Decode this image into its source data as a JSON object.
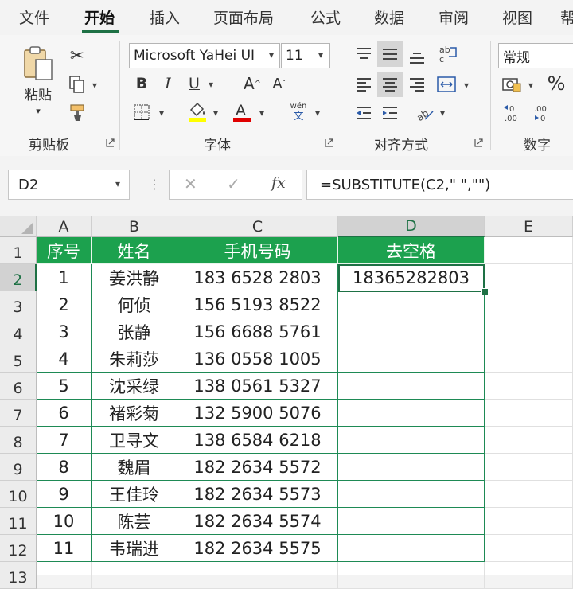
{
  "tabs": [
    "文件",
    "开始",
    "插入",
    "页面布局",
    "公式",
    "数据",
    "审阅",
    "视图",
    "帮"
  ],
  "active_tab": "开始",
  "ribbon": {
    "clipboard": {
      "paste_label": "粘贴",
      "group_label": "剪贴板"
    },
    "font": {
      "font_name": "Microsoft YaHei UI",
      "font_size": "11",
      "bold": "B",
      "italic": "I",
      "underline": "U",
      "grow": "A",
      "shrink": "A",
      "phonetic_top": "wén",
      "phonetic_bottom": "文",
      "group_label": "字体",
      "highlight_color": "#ffff00",
      "font_color": "#e00000"
    },
    "alignment": {
      "group_label": "对齐方式"
    },
    "number": {
      "format": "常规",
      "percent": "%",
      "group_label": "数字"
    }
  },
  "formula_bar": {
    "name_box": "D2",
    "fx": "fx",
    "formula": "=SUBSTITUTE(C2,\" \",\"\")"
  },
  "sheet": {
    "columns": [
      "A",
      "B",
      "C",
      "D",
      "E"
    ],
    "selected_column": "D",
    "selected_row": "2",
    "row_numbers": [
      "1",
      "2",
      "3",
      "4",
      "5",
      "6",
      "7",
      "8",
      "9",
      "10",
      "11",
      "12",
      "13"
    ],
    "headers": [
      "序号",
      "姓名",
      "手机号码",
      "去空格"
    ],
    "rows": [
      [
        "1",
        "姜洪静",
        "183 6528 2803",
        "18365282803"
      ],
      [
        "2",
        "何侦",
        "156 5193 8522",
        ""
      ],
      [
        "3",
        "张静",
        "156 6688 5761",
        ""
      ],
      [
        "4",
        "朱莉莎",
        "136 0558 1005",
        ""
      ],
      [
        "5",
        "沈采绿",
        "138 0561 5327",
        ""
      ],
      [
        "6",
        "褚彩菊",
        "132 5900 5076",
        ""
      ],
      [
        "7",
        "卫寻文",
        "138 6584 6218",
        ""
      ],
      [
        "8",
        "魏眉",
        "182 2634 5572",
        ""
      ],
      [
        "9",
        "王佳玲",
        "182 2634 5573",
        ""
      ],
      [
        "10",
        "陈芸",
        "182 2634 5574",
        ""
      ],
      [
        "11",
        "韦瑞进",
        "182 2634 5575",
        ""
      ]
    ],
    "header_color": "#1ca14e",
    "accent_color": "#1e7145"
  }
}
